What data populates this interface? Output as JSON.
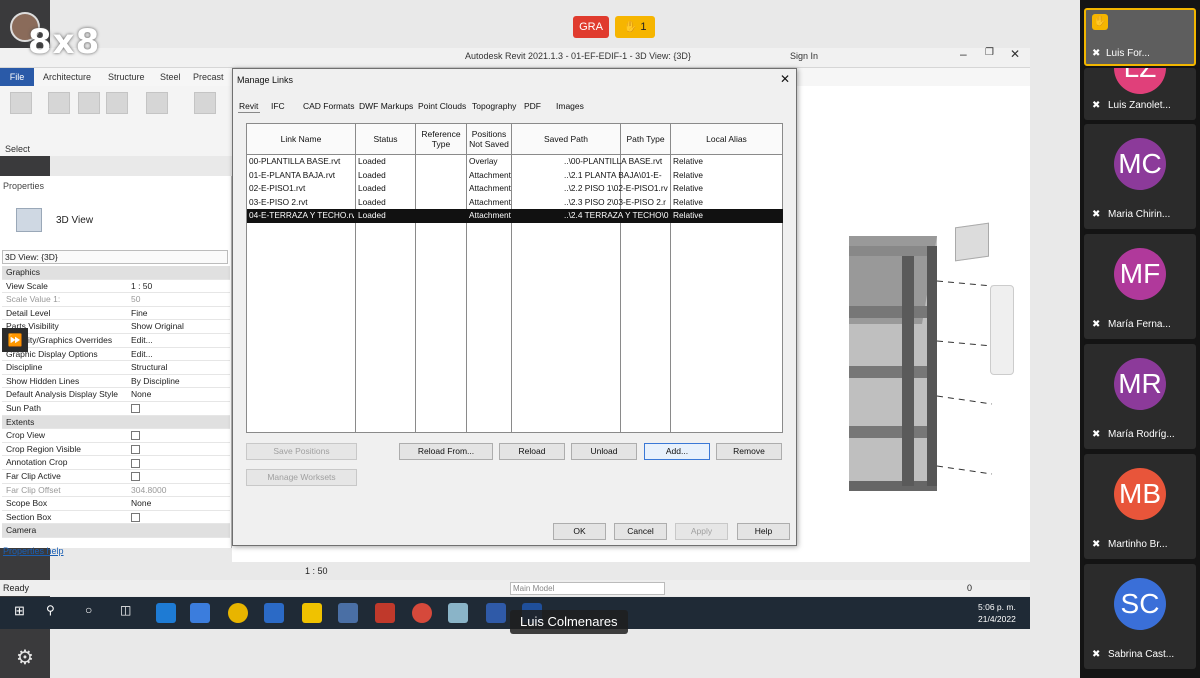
{
  "meeting": {
    "brand_logo": "8x8",
    "badge_gra": "GRA",
    "raised_hands": "1",
    "speaker_name": "Luis Colmenares"
  },
  "revit": {
    "title": "Autodesk Revit 2021.1.3 - 01-EF-EDIF-1 - 3D View: {3D}",
    "sign_in": "Sign In",
    "menu": [
      "File",
      "Architecture",
      "Structure",
      "Steel",
      "Precast"
    ],
    "select_label": "Select",
    "properties_title": "Properties",
    "type_name": "3D View",
    "type_selector": "3D View: {3D}",
    "properties": [
      {
        "k": "Graphics",
        "v": "",
        "hdr": true
      },
      {
        "k": "View Scale",
        "v": "1 : 50"
      },
      {
        "k": "Scale Value    1:",
        "v": "50",
        "dim": true
      },
      {
        "k": "Detail Level",
        "v": "Fine"
      },
      {
        "k": "Parts Visibility",
        "v": "Show Original"
      },
      {
        "k": "Visibility/Graphics Overrides",
        "v": "Edit..."
      },
      {
        "k": "Graphic Display Options",
        "v": "Edit..."
      },
      {
        "k": "Discipline",
        "v": "Structural"
      },
      {
        "k": "Show Hidden Lines",
        "v": "By Discipline"
      },
      {
        "k": "Default Analysis Display Style",
        "v": "None"
      },
      {
        "k": "Sun Path",
        "v": "",
        "chk": true
      },
      {
        "k": "Extents",
        "v": "",
        "hdr": true
      },
      {
        "k": "Crop View",
        "v": "",
        "chk": true
      },
      {
        "k": "Crop Region Visible",
        "v": "",
        "chk": true
      },
      {
        "k": "Annotation Crop",
        "v": "",
        "chk": true
      },
      {
        "k": "Far Clip Active",
        "v": "",
        "chk": true
      },
      {
        "k": "Far Clip Offset",
        "v": "304.8000",
        "dim": true
      },
      {
        "k": "Scope Box",
        "v": "None"
      },
      {
        "k": "Section Box",
        "v": "",
        "chk": true
      },
      {
        "k": "Camera",
        "v": "",
        "hdr": true
      }
    ],
    "properties_help": "Properties help",
    "view_scale": "1 : 50",
    "status_ready": "Ready",
    "main_model": "Main Model",
    "status_zero": "0"
  },
  "dialog": {
    "title": "Manage Links",
    "tabs": [
      "Revit",
      "IFC",
      "CAD Formats",
      "DWF Markups",
      "Point Clouds",
      "Topography",
      "PDF",
      "Images"
    ],
    "columns": [
      "Link Name",
      "Status",
      "Reference Type",
      "Positions Not Saved",
      "Saved Path",
      "Path Type",
      "Local Alias"
    ],
    "rows": [
      {
        "name": "00-PLANTILLA BASE.rvt",
        "status": "Loaded",
        "ref": "Overlay",
        "path": "..\\00-PLANTILLA BASE.rvt",
        "ptype": "Relative"
      },
      {
        "name": "01-E-PLANTA BAJA.rvt",
        "status": "Loaded",
        "ref": "Attachment",
        "path": "..\\2.1 PLANTA BAJA\\01-E-",
        "ptype": "Relative"
      },
      {
        "name": "02-E-PISO1.rvt",
        "status": "Loaded",
        "ref": "Attachment",
        "path": "..\\2.2 PISO 1\\02-E-PISO1.rv",
        "ptype": "Relative"
      },
      {
        "name": "03-E-PISO 2.rvt",
        "status": "Loaded",
        "ref": "Attachment",
        "path": "..\\2.3 PISO 2\\03-E-PISO 2.r",
        "ptype": "Relative"
      },
      {
        "name": "04-E-TERRAZA Y TECHO.rv",
        "status": "Loaded",
        "ref": "Attachment",
        "path": "..\\2.4 TERRAZA Y TECHO\\0",
        "ptype": "Relative"
      }
    ],
    "btn_save_positions": "Save Positions",
    "btn_manage_worksets": "Manage Worksets",
    "btn_reload_from": "Reload From...",
    "btn_reload": "Reload",
    "btn_unload": "Unload",
    "btn_add": "Add...",
    "btn_remove": "Remove",
    "btn_ok": "OK",
    "btn_cancel": "Cancel",
    "btn_apply": "Apply",
    "btn_help": "Help"
  },
  "taskbar": {
    "time": "5:06 p. m.",
    "date": "21/4/2022"
  },
  "participants": [
    {
      "name": "Luis For...",
      "initials": "",
      "color": "#5e5e5e"
    },
    {
      "name": "Luis Zanolet...",
      "initials": "LZ",
      "color": "#e0407a"
    },
    {
      "name": "Maria Chirin...",
      "initials": "MC",
      "color": "#8c3a9a"
    },
    {
      "name": "María Ferna...",
      "initials": "MF",
      "color": "#b0399b"
    },
    {
      "name": "María Rodríg...",
      "initials": "MR",
      "color": "#8c3a9a"
    },
    {
      "name": "Martinho Br...",
      "initials": "MB",
      "color": "#e8553a"
    },
    {
      "name": "Sabrina Cast...",
      "initials": "SC",
      "color": "#3a6fd8"
    }
  ]
}
